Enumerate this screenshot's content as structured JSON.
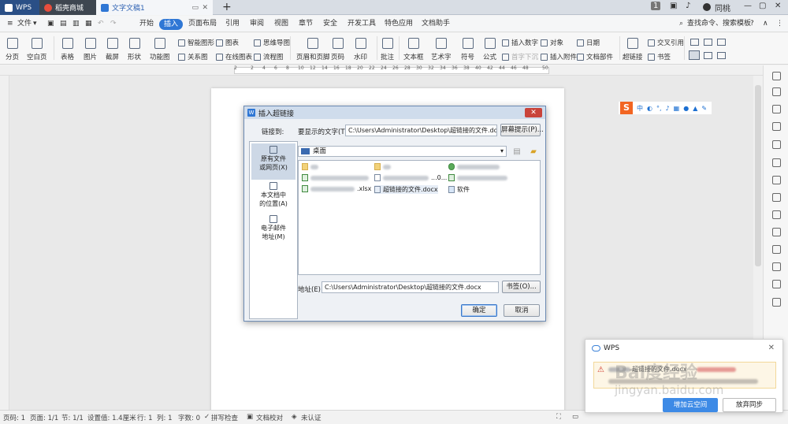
{
  "titlebar": {
    "tabs": [
      {
        "label": "WPS"
      },
      {
        "label": "稻壳商城"
      },
      {
        "label": "文字文稿1"
      }
    ],
    "add_tab": "+",
    "badge": "1",
    "user": "同桃"
  },
  "menubar": {
    "file": "文件",
    "items": [
      "开始",
      "插入",
      "页面布局",
      "引用",
      "审阅",
      "视图",
      "章节",
      "安全",
      "开发工具",
      "特色应用",
      "文档助手"
    ],
    "active": "插入",
    "search": "查找命令、搜索模板",
    "help": "?"
  },
  "ribbon": {
    "big": [
      "分页",
      "空白页",
      "表格",
      "图片",
      "截屏",
      "形状",
      "功能图",
      "页眉和页脚",
      "页码",
      "水印",
      "批注",
      "文本框",
      "艺术字",
      "符号",
      "公式",
      "超链接"
    ],
    "small": [
      "智能图形",
      "图表",
      "思维导图",
      "关系图",
      "在线图表",
      "流程图",
      "插入数字",
      "首字下沉",
      "对象",
      "插入附件",
      "日期",
      "文档部件",
      "交叉引用",
      "书签"
    ]
  },
  "ruler": {
    "ticks": [
      "2",
      "2",
      "4",
      "6",
      "8",
      "10",
      "12",
      "14",
      "16",
      "18",
      "20",
      "22",
      "24",
      "26",
      "28",
      "30",
      "32",
      "34",
      "36",
      "38",
      "40",
      "42",
      "44",
      "46",
      "48",
      "50"
    ]
  },
  "dialog": {
    "title": "插入超链接",
    "link_to": "链接到:",
    "display_text_label": "要显示的文字(T):",
    "display_text": "C:\\Users\\Administrator\\Desktop\\超链接的文件.docx",
    "screen_tip": "屏幕提示(P)...",
    "link_options": [
      {
        "label1": "原有文件",
        "label2": "或网页(X)"
      },
      {
        "label1": "本文档中",
        "label2": "的位置(A)"
      },
      {
        "label1": "电子邮件",
        "label2": "地址(M)"
      }
    ],
    "folder": "桌面",
    "files": [
      {
        "name": "",
        "col": 0,
        "row": 0
      },
      {
        "name": "",
        "col": 1,
        "row": 0
      },
      {
        "name": "",
        "col": 2,
        "row": 0
      },
      {
        "name": "",
        "col": 0,
        "row": 1
      },
      {
        "name": "...0...",
        "col": 1,
        "row": 1
      },
      {
        "name": "",
        "col": 2,
        "row": 1
      },
      {
        "name": ".xlsx",
        "col": 0,
        "row": 2
      },
      {
        "name": "超链接的文件.docx",
        "col": 1,
        "row": 2
      },
      {
        "name": "软件",
        "col": 2,
        "row": 2
      }
    ],
    "address_label": "地址(E):",
    "address": "C:\\Users\\Administrator\\Desktop\\超链接的文件.docx",
    "bookmark": "书签(O)...",
    "ok": "确定",
    "cancel": "取消"
  },
  "ime": {
    "logo": "S",
    "mode": "中"
  },
  "status": {
    "page": "页码: 1",
    "pages": "页面: 1/1",
    "section": "节: 1/1",
    "setting": "设置值: 1.4厘米",
    "row": "行: 1",
    "col": "列: 1",
    "words": "字数: 0",
    "spell": "拼写检查",
    "proof": "文档校对",
    "cert": "未认证"
  },
  "notify": {
    "title": "WPS",
    "line1": "超链接的文件.docx",
    "line2": "",
    "btn_primary": "增加云空间",
    "btn_secondary": "放弃同步"
  },
  "watermark": {
    "main": "Bai度经验",
    "sub": "jingyan.baidu.com"
  }
}
